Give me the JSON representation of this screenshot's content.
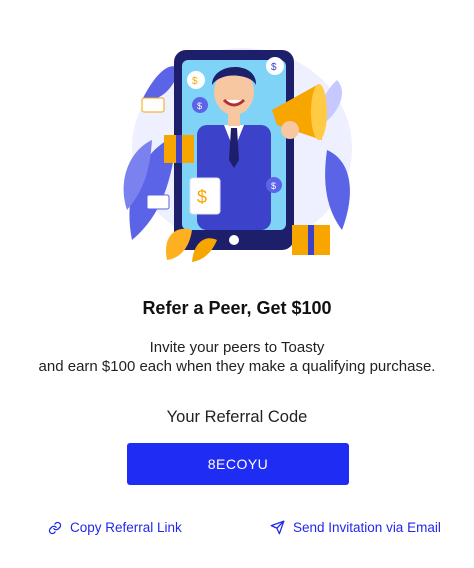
{
  "referral": {
    "title": "Refer a Peer, Get $100",
    "description_line1": "Invite your peers to Toasty",
    "description_line2": "and earn $100 each when they make a qualifying purchase.",
    "code_label": "Your Referral Code",
    "code": "8ECOYU"
  },
  "actions": {
    "copy_link": "Copy Referral Link",
    "send_email": "Send Invitation via Email"
  },
  "icons": {
    "copy": "link-icon",
    "send": "paper-plane-icon"
  },
  "colors": {
    "accent": "#1f2cf4",
    "link": "#2328e8"
  }
}
